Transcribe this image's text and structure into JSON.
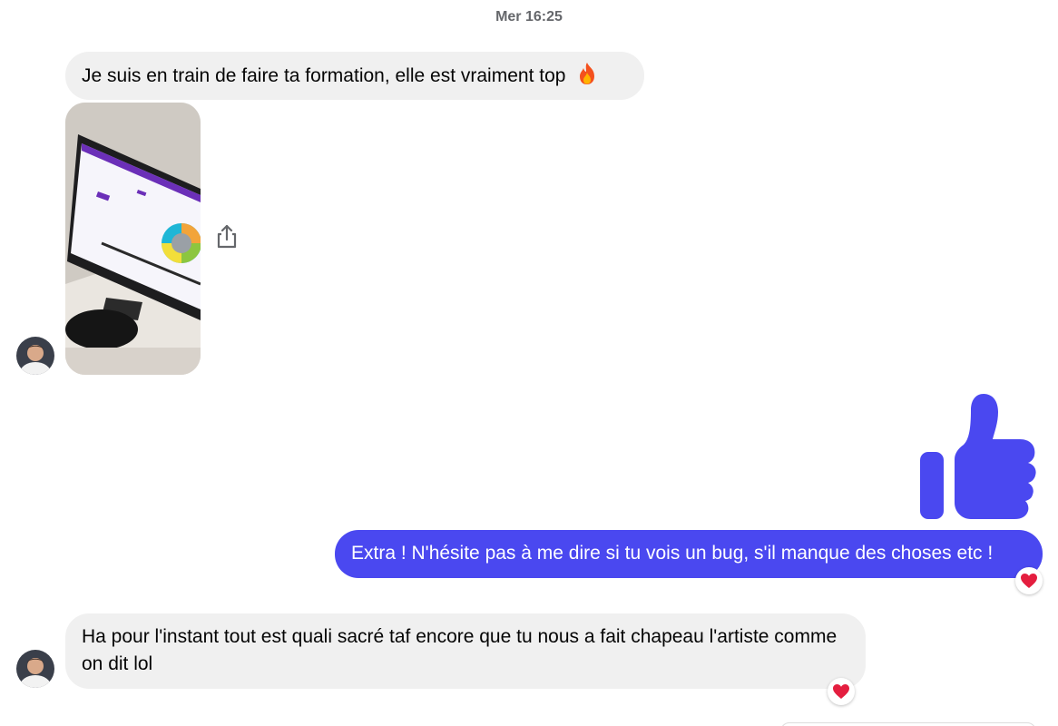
{
  "header": {
    "timestamp": "Mer 16:25"
  },
  "messages": [
    {
      "from": "other",
      "text": "Je suis en train de faire ta formation, elle est vraiment top"
    },
    {
      "from": "other",
      "type": "photo",
      "icon": "shared-photo-image"
    },
    {
      "from": "me",
      "type": "like",
      "icon": "thumbs-up-icon"
    },
    {
      "from": "me",
      "text": "Extra ! N'hésite pas à me dire si tu vois un bug, s'il manque des choses etc !",
      "reaction": "heart"
    },
    {
      "from": "other",
      "text": "Ha pour l'instant tout est quali sacré taf encore que tu nous a fait chapeau l'artiste comme on dit lol",
      "reaction": "heart"
    }
  ],
  "colors": {
    "outgoing_bubble": "#4a48f0",
    "incoming_bubble": "#f0f0f0",
    "heart": "#e41e3f"
  },
  "icons": [
    "fire-emoji",
    "share-icon",
    "thumbs-up-icon",
    "heart-reaction-icon",
    "avatar"
  ]
}
